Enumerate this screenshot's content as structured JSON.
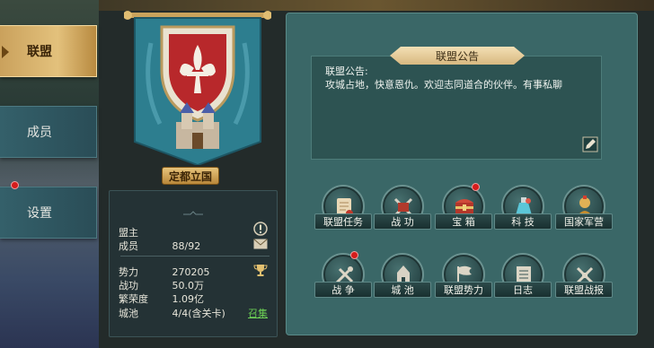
{
  "tabs": [
    {
      "label": "联盟",
      "active": true
    },
    {
      "label": "成员",
      "active": false
    },
    {
      "label": "设置",
      "active": false,
      "badge": true
    }
  ],
  "city": {
    "label": "定都立国"
  },
  "info": {
    "leader_label": "盟主",
    "leader_value": "",
    "members_label": "成员",
    "members_value": "88/92",
    "power_label": "势力",
    "power_value": "270205",
    "merit_label": "战功",
    "merit_value": "50.0万",
    "prosperity_label": "繁荣度",
    "prosperity_value": "1.09亿",
    "cities_label": "城池",
    "cities_value": "4/4(含关卡)",
    "recruit_label": "召集"
  },
  "notice": {
    "title": "联盟公告",
    "text": "联盟公告:\n攻城占地，快意恩仇。欢迎志同道合的伙伴。有事私聊"
  },
  "functions": [
    {
      "label": "联盟任务",
      "icon": "scroll-icon",
      "badge": false
    },
    {
      "label": "战 功",
      "icon": "crossed-swords-icon",
      "badge": false
    },
    {
      "label": "宝 箱",
      "icon": "treasure-chest-icon",
      "badge": true
    },
    {
      "label": "科 技",
      "icon": "potion-icon",
      "badge": false
    },
    {
      "label": "国家军营",
      "icon": "soldier-icon",
      "badge": false
    },
    {
      "label": "战 争",
      "icon": "battle-icon",
      "badge": true
    },
    {
      "label": "城 池",
      "icon": "castle-icon",
      "badge": false
    },
    {
      "label": "联盟势力",
      "icon": "flag-icon",
      "badge": false
    },
    {
      "label": "日志",
      "icon": "log-icon",
      "badge": false
    },
    {
      "label": "联盟战报",
      "icon": "report-icon",
      "badge": false
    }
  ],
  "colors": {
    "gold": "#e3c17c",
    "teal_panel": "#3a6767",
    "red_badge": "#d41c1c",
    "recruit_green": "#6ccf55"
  }
}
